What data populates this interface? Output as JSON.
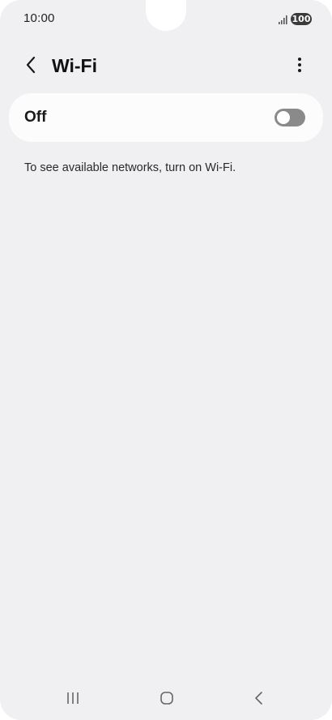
{
  "status_bar": {
    "time": "10:00",
    "battery": "100",
    "icons": [
      "signal-icon",
      "battery-icon"
    ]
  },
  "header": {
    "title": "Wi-Fi",
    "back_icon": "chevron-left-icon",
    "more_icon": "more-vertical-icon"
  },
  "wifi_toggle": {
    "label": "Off",
    "state": "off"
  },
  "info": {
    "message": "To see available networks, turn on Wi-Fi."
  },
  "nav_bar": {
    "icons": [
      "recents-icon",
      "home-icon",
      "back-icon"
    ]
  },
  "colors": {
    "background": "#f0f0f2",
    "card": "#fcfcfc",
    "toggle_off": "#8a8a8a",
    "text": "#1a1a1a"
  }
}
